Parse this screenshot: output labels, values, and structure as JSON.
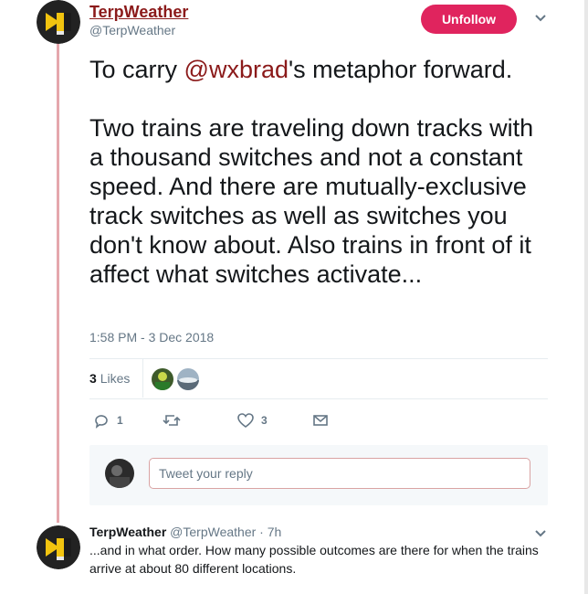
{
  "tweet": {
    "author_name": "TerpWeather",
    "author_handle": "@TerpWeather",
    "follow_button": "Unfollow",
    "text_before": "To carry ",
    "mention": "@wxbrad",
    "text_after": "'s metaphor forward.\n\nTwo trains are traveling down tracks with a thousand switches and not a constant speed. And there are mutually-exclusive track switches as well as switches you don't know about. Also trains in front of it affect what switches activate...",
    "timestamp": "1:58 PM - 3 Dec 2018",
    "likes_count": "3",
    "likes_label": "Likes",
    "actions": {
      "reply_count": "1",
      "retweet_count": "",
      "like_count": "3"
    }
  },
  "reply_composer": {
    "placeholder": "Tweet your reply"
  },
  "reply": {
    "author_name": "TerpWeather",
    "author_handle": "@TerpWeather",
    "age": "· 7h",
    "text": "...and in what order. How many possible outcomes are there for when the trains arrive at about 80 different locations."
  },
  "colors": {
    "accent": "#e0245e",
    "brand_red": "#8b1a1a",
    "thread_line": "#e5a7ad"
  }
}
